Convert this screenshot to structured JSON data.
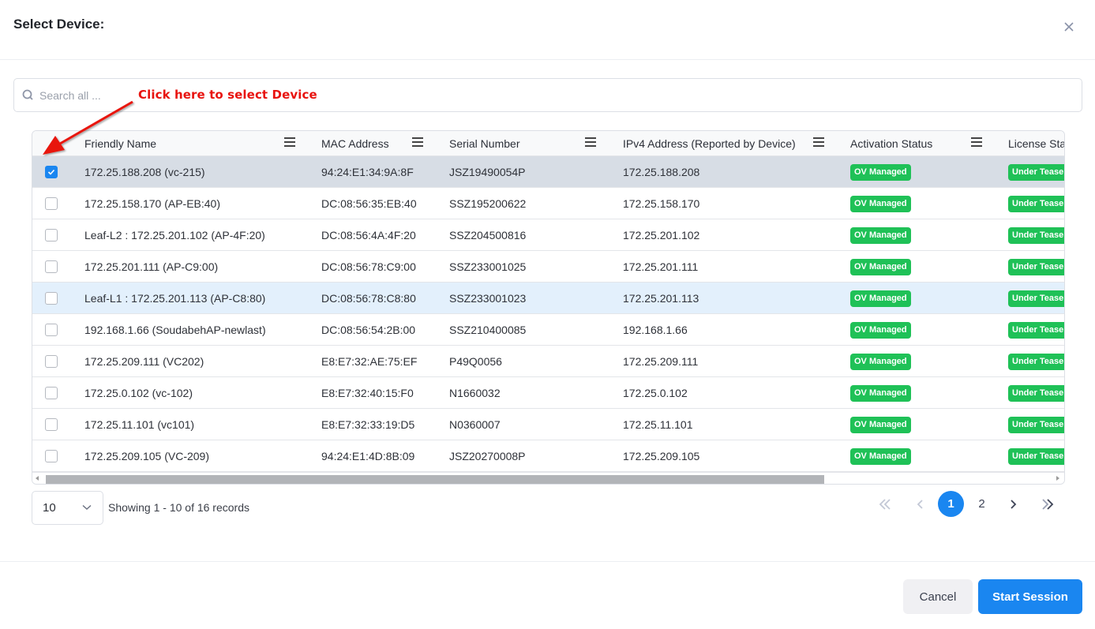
{
  "modal": {
    "title": "Select Device:",
    "close_icon": "close-icon"
  },
  "search": {
    "placeholder": "Search all ...",
    "value": "",
    "icon": "search-icon"
  },
  "annotation": {
    "text": "Click here to select Device",
    "color": "#e8130f"
  },
  "table": {
    "columns": [
      {
        "label": "Friendly Name"
      },
      {
        "label": "MAC Address"
      },
      {
        "label": "Serial Number"
      },
      {
        "label": "IPv4 Address (Reported by Device)"
      },
      {
        "label": "Activation Status"
      },
      {
        "label": "License Stat"
      }
    ],
    "rows": [
      {
        "selected": true,
        "friendly_name": "172.25.188.208 (vc-215)",
        "mac": "94:24:E1:34:9A:8F",
        "serial": "JSZ19490054P",
        "ipv4": "172.25.188.208",
        "activation": "OV Managed",
        "license": "Under Teaser"
      },
      {
        "selected": false,
        "friendly_name": "172.25.158.170 (AP-EB:40)",
        "mac": "DC:08:56:35:EB:40",
        "serial": "SSZ195200622",
        "ipv4": "172.25.158.170",
        "activation": "OV Managed",
        "license": "Under Teaser"
      },
      {
        "selected": false,
        "friendly_name": "Leaf-L2 : 172.25.201.102 (AP-4F:20)",
        "mac": "DC:08:56:4A:4F:20",
        "serial": "SSZ204500816",
        "ipv4": "172.25.201.102",
        "activation": "OV Managed",
        "license": "Under Teaser"
      },
      {
        "selected": false,
        "friendly_name": "172.25.201.111 (AP-C9:00)",
        "mac": "DC:08:56:78:C9:00",
        "serial": "SSZ233001025",
        "ipv4": "172.25.201.111",
        "activation": "OV Managed",
        "license": "Under Teaser"
      },
      {
        "selected": false,
        "hover": true,
        "friendly_name": "Leaf-L1 : 172.25.201.113 (AP-C8:80)",
        "mac": "DC:08:56:78:C8:80",
        "serial": "SSZ233001023",
        "ipv4": "172.25.201.113",
        "activation": "OV Managed",
        "license": "Under Teaser"
      },
      {
        "selected": false,
        "friendly_name": "192.168.1.66 (SoudabehAP-newlast)",
        "mac": "DC:08:56:54:2B:00",
        "serial": "SSZ210400085",
        "ipv4": "192.168.1.66",
        "activation": "OV Managed",
        "license": "Under Teaser"
      },
      {
        "selected": false,
        "friendly_name": "172.25.209.111 (VC202)",
        "mac": "E8:E7:32:AE:75:EF",
        "serial": "P49Q0056",
        "ipv4": "172.25.209.111",
        "activation": "OV Managed",
        "license": "Under Teaser"
      },
      {
        "selected": false,
        "friendly_name": "172.25.0.102 (vc-102)",
        "mac": "E8:E7:32:40:15:F0",
        "serial": "N1660032",
        "ipv4": "172.25.0.102",
        "activation": "OV Managed",
        "license": "Under Teaser"
      },
      {
        "selected": false,
        "friendly_name": "172.25.11.101 (vc101)",
        "mac": "E8:E7:32:33:19:D5",
        "serial": "N0360007",
        "ipv4": "172.25.11.101",
        "activation": "OV Managed",
        "license": "Under Teaser"
      },
      {
        "selected": false,
        "friendly_name": "172.25.209.105 (VC-209)",
        "mac": "94:24:E1:4D:8B:09",
        "serial": "JSZ20270008P",
        "ipv4": "172.25.209.105",
        "activation": "OV Managed",
        "license": "Under Teaser"
      }
    ],
    "badge_color": "#1fc157"
  },
  "pagination": {
    "page_size": "10",
    "records_text": "Showing 1 - 10 of 16 records",
    "pages": [
      "1",
      "2"
    ],
    "current_page": "1",
    "first_icon": "double-chevron-left-icon",
    "prev_icon": "chevron-left-icon",
    "next_icon": "chevron-right-icon",
    "last_icon": "double-chevron-right-icon"
  },
  "footer": {
    "cancel_label": "Cancel",
    "start_label": "Start Session"
  },
  "colors": {
    "accent": "#1a86f0",
    "selected_row": "#d7dde5",
    "hover_row": "#e3f0fc"
  }
}
